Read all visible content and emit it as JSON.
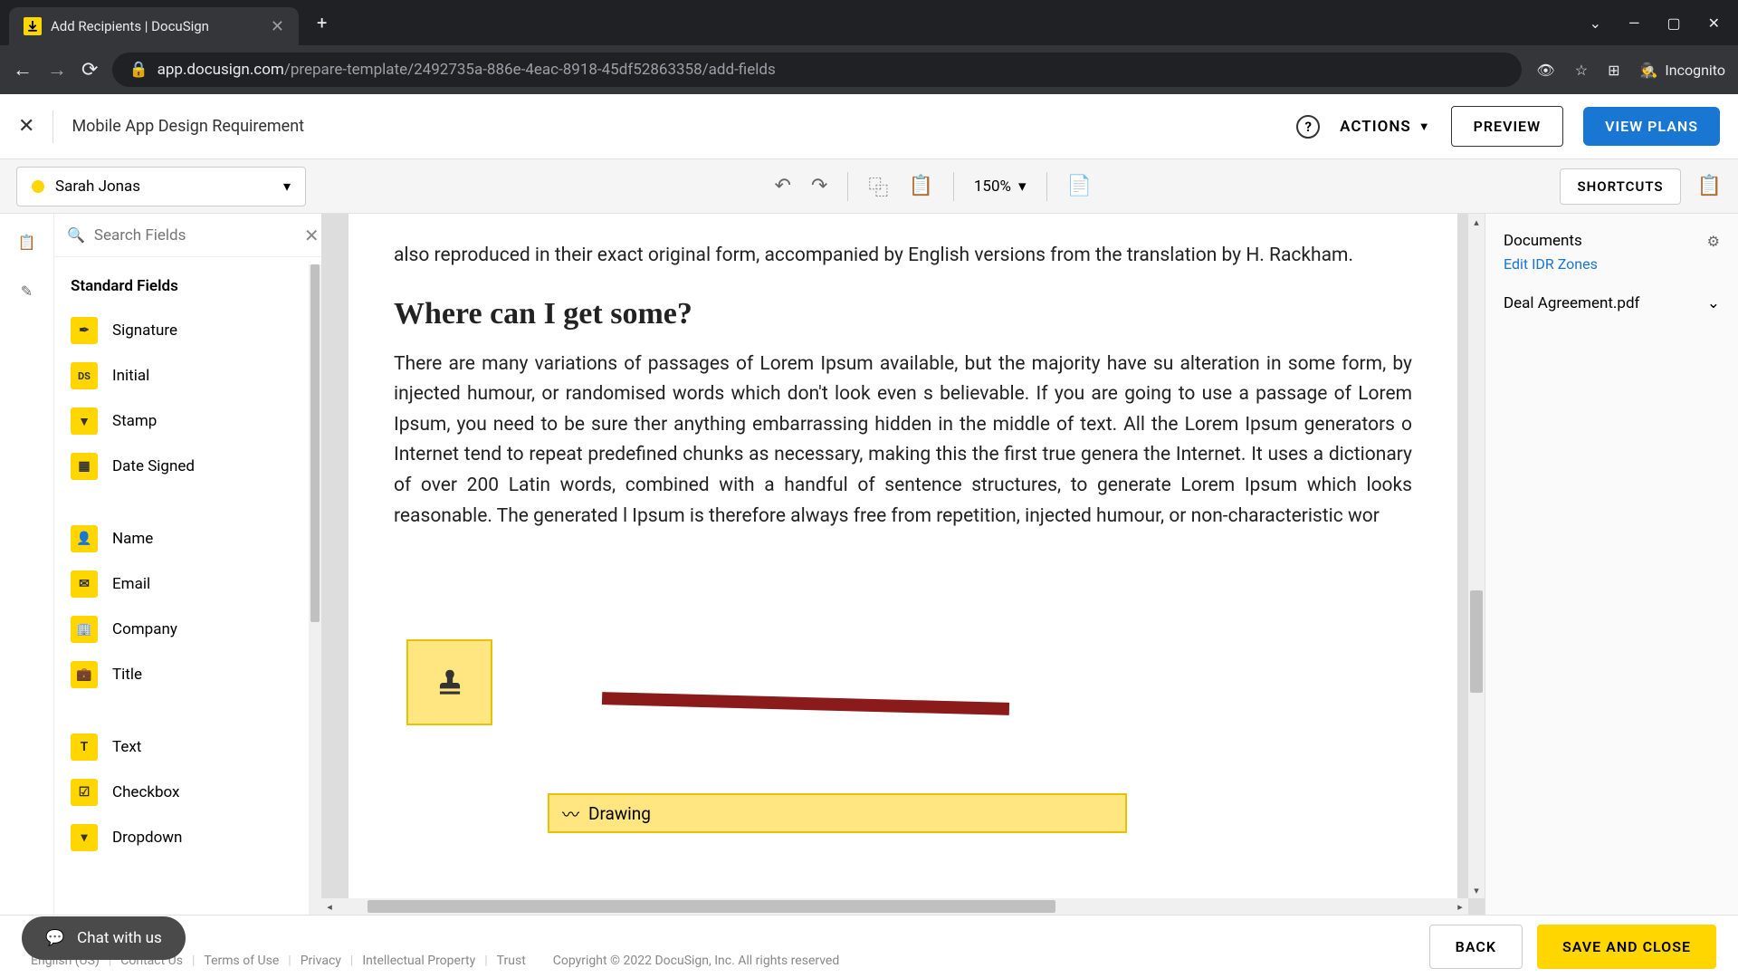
{
  "browser": {
    "tab_title": "Add Recipients | DocuSign",
    "url_host": "app.docusign.com",
    "url_path": "/prepare-template/2492735a-886e-4eac-8918-45df52863358/add-fields",
    "incognito": "Incognito"
  },
  "header": {
    "doc_title": "Mobile App Design Requirement",
    "actions": "ACTIONS",
    "preview": "PREVIEW",
    "view_plans": "VIEW PLANS"
  },
  "toolbar": {
    "recipient": "Sarah Jonas",
    "zoom": "150%",
    "shortcuts": "SHORTCUTS"
  },
  "sidebar": {
    "search_placeholder": "Search Fields",
    "section": "Standard Fields",
    "fields": [
      {
        "label": "Signature",
        "icon": "✒"
      },
      {
        "label": "Initial",
        "icon": "DS"
      },
      {
        "label": "Stamp",
        "icon": "⊞"
      },
      {
        "label": "Date Signed",
        "icon": "▦"
      }
    ],
    "fields2": [
      {
        "label": "Name",
        "icon": "👤"
      },
      {
        "label": "Email",
        "icon": "✉"
      },
      {
        "label": "Company",
        "icon": "🏢"
      },
      {
        "label": "Title",
        "icon": "💼"
      }
    ],
    "fields3": [
      {
        "label": "Text",
        "icon": "T"
      },
      {
        "label": "Checkbox",
        "icon": "☑"
      },
      {
        "label": "Dropdown",
        "icon": "▾"
      }
    ]
  },
  "doc": {
    "para1": "also reproduced in their exact original form, accompanied by English versions from the translation by H. Rackham.",
    "heading": "Where can I get some?",
    "para2": "There are many variations of passages of Lorem Ipsum available, but the majority have su alteration in some form, by injected humour, or randomised words which don't look even s believable. If you are going to use a passage of Lorem Ipsum, you need to be sure ther anything embarrassing hidden in the middle of text. All the Lorem Ipsum generators o Internet tend to repeat predefined chunks as necessary, making this the first true genera the Internet. It uses a dictionary of over 200 Latin words, combined with a handful of sentence structures, to generate Lorem Ipsum which looks reasonable. The generated l Ipsum is therefore always free from repetition, injected humour, or non-characteristic wor",
    "drawing_label": "Drawing"
  },
  "right": {
    "title": "Documents",
    "link": "Edit IDR Zones",
    "doc_name": "Deal Agreement.pdf"
  },
  "footer": {
    "chat": "Chat with us",
    "links": [
      "English (US)",
      "Contact Us",
      "Terms of Use",
      "Privacy",
      "Intellectual Property",
      "Trust"
    ],
    "copyright": "Copyright © 2022 DocuSign, Inc. All rights reserved",
    "back": "BACK",
    "save": "SAVE AND CLOSE"
  }
}
